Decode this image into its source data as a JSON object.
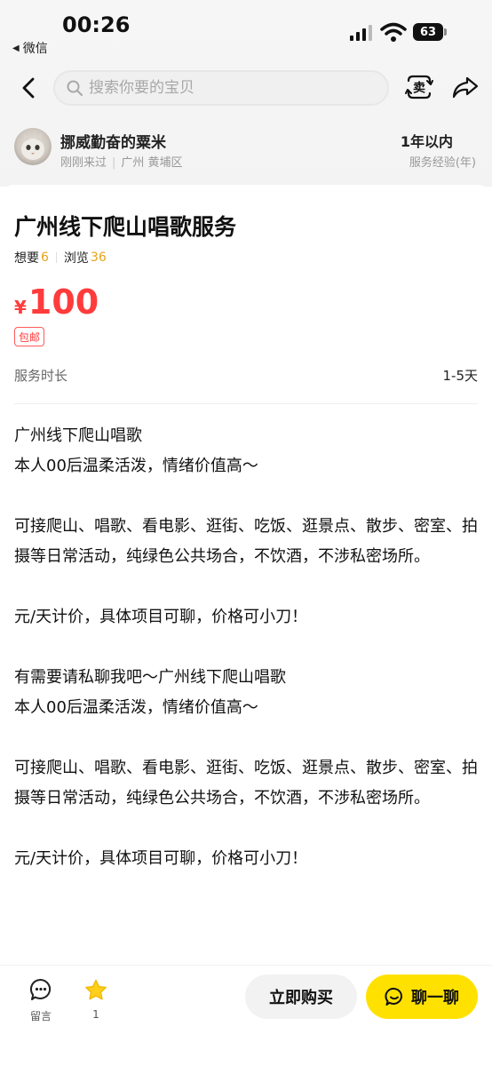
{
  "status_bar": {
    "time": "00:26",
    "back_app": "微信",
    "battery": "63"
  },
  "nav": {
    "search_placeholder": "搜索你要的宝贝",
    "sell_icon_text": "卖"
  },
  "seller": {
    "name": "挪威勤奋的粟米",
    "last_seen": "刚刚来过",
    "location": "广州 黄埔区",
    "experience_value": "1年以内",
    "experience_label": "服务经验(年)"
  },
  "listing": {
    "title": "广州线下爬山唱歌服务",
    "want_label": "想要",
    "want_count": "6",
    "views_label": "浏览",
    "views_count": "36",
    "currency": "¥",
    "price": "100",
    "shipping_badge": "包邮",
    "duration_label": "服务时长",
    "duration_value": "1-5天",
    "description": [
      "广州线下爬山唱歌\n本人00后温柔活泼，情绪价值高～",
      "可接爬山、唱歌、看电影、逛街、吃饭、逛景点、散步、密室、拍摄等日常活动，纯绿色公共场合，不饮酒，不涉私密场所。",
      "元/天计价，具体项目可聊，价格可小刀！",
      "有需要请私聊我吧～广州线下爬山唱歌\n本人00后温柔活泼，情绪价值高～",
      "可接爬山、唱歌、看电影、逛街、吃饭、逛景点、散步、密室、拍摄等日常活动，纯绿色公共场合，不饮酒，不涉私密场所。",
      "元/天计价，具体项目可聊，价格可小刀！"
    ]
  },
  "bottom_bar": {
    "comment_label": "留言",
    "favorite_count": "1",
    "buy_label": "立即购买",
    "chat_label": "聊一聊"
  },
  "colors": {
    "price": "#ff3b3b",
    "stat_number": "#e8a317",
    "chat_button": "#ffe100",
    "favorite_star": "#ffcf1a"
  }
}
